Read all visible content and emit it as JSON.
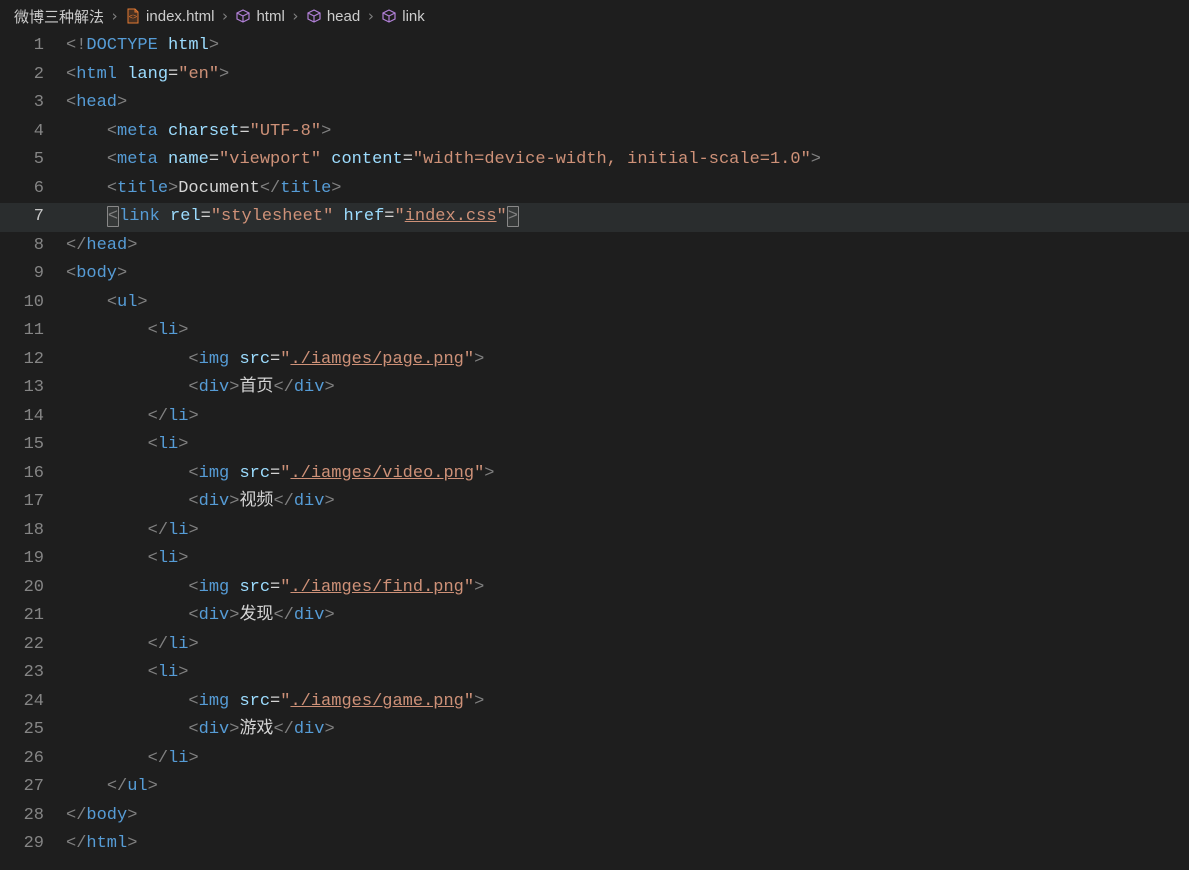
{
  "breadcrumb": {
    "items": [
      {
        "label": "微博三种解法",
        "icon": null
      },
      {
        "label": "index.html",
        "icon": "file"
      },
      {
        "label": "html",
        "icon": "symbol"
      },
      {
        "label": "head",
        "icon": "symbol"
      },
      {
        "label": "link",
        "icon": "symbol"
      }
    ],
    "separator": "›"
  },
  "editor": {
    "active_line": 7,
    "lines": [
      {
        "n": 1,
        "indent": 0
      },
      {
        "n": 2,
        "indent": 0
      },
      {
        "n": 3,
        "indent": 0
      },
      {
        "n": 4,
        "indent": 1
      },
      {
        "n": 5,
        "indent": 1
      },
      {
        "n": 6,
        "indent": 1
      },
      {
        "n": 7,
        "indent": 1
      },
      {
        "n": 8,
        "indent": 0
      },
      {
        "n": 9,
        "indent": 0
      },
      {
        "n": 10,
        "indent": 1
      },
      {
        "n": 11,
        "indent": 2
      },
      {
        "n": 12,
        "indent": 3
      },
      {
        "n": 13,
        "indent": 3
      },
      {
        "n": 14,
        "indent": 2
      },
      {
        "n": 15,
        "indent": 2
      },
      {
        "n": 16,
        "indent": 3
      },
      {
        "n": 17,
        "indent": 3
      },
      {
        "n": 18,
        "indent": 2
      },
      {
        "n": 19,
        "indent": 2
      },
      {
        "n": 20,
        "indent": 3
      },
      {
        "n": 21,
        "indent": 3
      },
      {
        "n": 22,
        "indent": 2
      },
      {
        "n": 23,
        "indent": 2
      },
      {
        "n": 24,
        "indent": 3
      },
      {
        "n": 25,
        "indent": 3
      },
      {
        "n": 26,
        "indent": 2
      },
      {
        "n": 27,
        "indent": 1
      },
      {
        "n": 28,
        "indent": 0
      },
      {
        "n": 29,
        "indent": 0
      }
    ]
  },
  "code": {
    "lang": "en",
    "charset": "UTF-8",
    "viewport_name": "viewport",
    "viewport_content": "width=device-width, initial-scale=1.0",
    "title_text": "Document",
    "link_rel": "stylesheet",
    "link_href": "index.css",
    "nav_items": [
      {
        "img_src": "./iamges/page.png",
        "label": "首页"
      },
      {
        "img_src": "./iamges/video.png",
        "label": "视频"
      },
      {
        "img_src": "./iamges/find.png",
        "label": "发现"
      },
      {
        "img_src": "./iamges/game.png",
        "label": "游戏"
      }
    ]
  }
}
